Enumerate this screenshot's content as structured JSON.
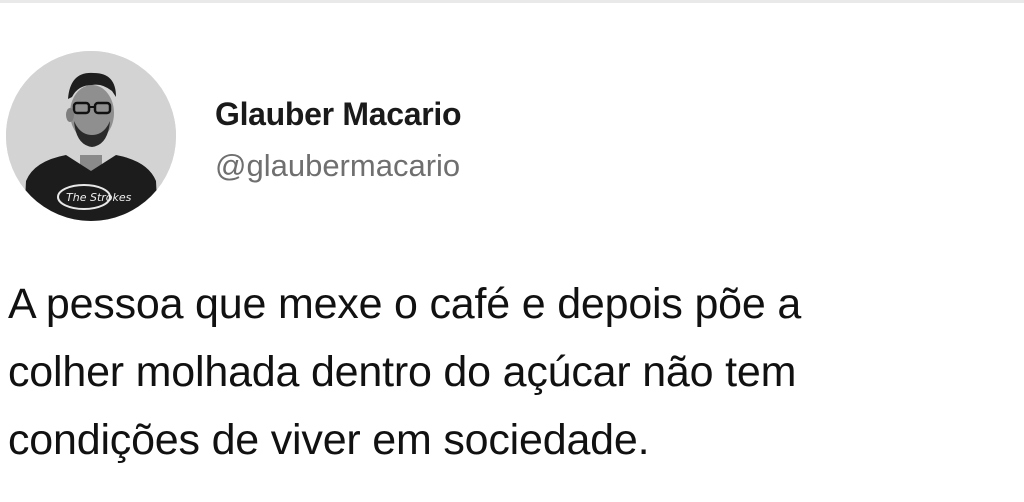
{
  "tweet": {
    "author": {
      "display_name": "Glauber Macario",
      "handle": "@glaubermacario",
      "avatar_icon": "user-avatar-photo",
      "shirt_logo_text": "The Strokes"
    },
    "text_lines": [
      "A pessoa que mexe o café e depois põe a",
      "colher molhada dentro do açúcar não tem",
      "condições de viver em sociedade."
    ]
  }
}
